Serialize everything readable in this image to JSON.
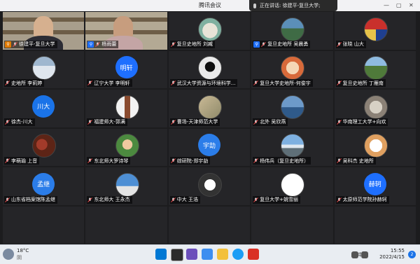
{
  "window": {
    "title": "腾讯会议",
    "speaking_label": "正在讲话: 徐建平-复旦大学;"
  },
  "colors": {
    "accent_blue": "#1e6fff",
    "teal_avatar": "#1a73e8"
  },
  "participants": [
    {
      "name": "徐建平-复旦大学",
      "type": "video",
      "host": true
    },
    {
      "name": "杨雨蕾",
      "type": "video",
      "host": true
    },
    {
      "name": "复旦史地所 刘臧",
      "type": "picture",
      "pic": "cartoon-cat"
    },
    {
      "name": "复旦史地所 吴晨勇",
      "type": "picture",
      "pic": "scenery",
      "host": true
    },
    {
      "name": "张晓 山大",
      "type": "picture",
      "pic": "emblem"
    },
    {
      "name": "史地所 李莉婷",
      "type": "picture",
      "pic": "snowy-landscape"
    },
    {
      "name": "辽宁大学 李明轩",
      "type": "initials",
      "initials": "明轩"
    },
    {
      "name": "武汉大学资源与环境科学...",
      "type": "picture",
      "pic": "dark-figure"
    },
    {
      "name": "复旦大学史地所-何俊宇",
      "type": "picture",
      "pic": "cartoon-face"
    },
    {
      "name": "复旦史地所 丁雁南",
      "type": "picture",
      "pic": "tree"
    },
    {
      "name": "徐杰-川大",
      "type": "initials",
      "initials": "川大"
    },
    {
      "name": "福建师大-郭满",
      "type": "picture",
      "pic": "standing-person"
    },
    {
      "name": "曹场-天津师范大学",
      "type": "picture",
      "pic": "map"
    },
    {
      "name": "北外 吴欣燕",
      "type": "picture",
      "pic": "blue-water"
    },
    {
      "name": "华南理工大学+向欢",
      "type": "picture",
      "pic": "animal"
    },
    {
      "name": "李萌瑜 上音",
      "type": "picture",
      "pic": "flower-bouquet"
    },
    {
      "name": "东北师大罗诗琴",
      "type": "picture",
      "pic": "child"
    },
    {
      "name": "综研院-郑宇劼",
      "type": "initials",
      "initials": "宇劼"
    },
    {
      "name": "杨伟兵（复旦史地所）",
      "type": "picture",
      "pic": "mountains"
    },
    {
      "name": "吴科杰 史地所",
      "type": "picture",
      "pic": "cartoon-cow"
    },
    {
      "name": "山东省档案馆陈孟继",
      "type": "initials",
      "initials": "孟继"
    },
    {
      "name": "东北师大 王永杰",
      "type": "picture",
      "pic": "building-sky"
    },
    {
      "name": "中大 王浩",
      "type": "picture",
      "pic": "cartoon-eyes"
    },
    {
      "name": "复旦大学+姚雪丽",
      "type": "picture",
      "pic": "white-circle"
    },
    {
      "name": "太原师范学院孙赫轲",
      "type": "initials",
      "initials": "赫轲"
    }
  ],
  "taskbar": {
    "weather_temp": "18°C",
    "weather_desc": "阴",
    "lang": "中",
    "time": "15:55",
    "date": "2022/4/15",
    "notifications": "2"
  }
}
